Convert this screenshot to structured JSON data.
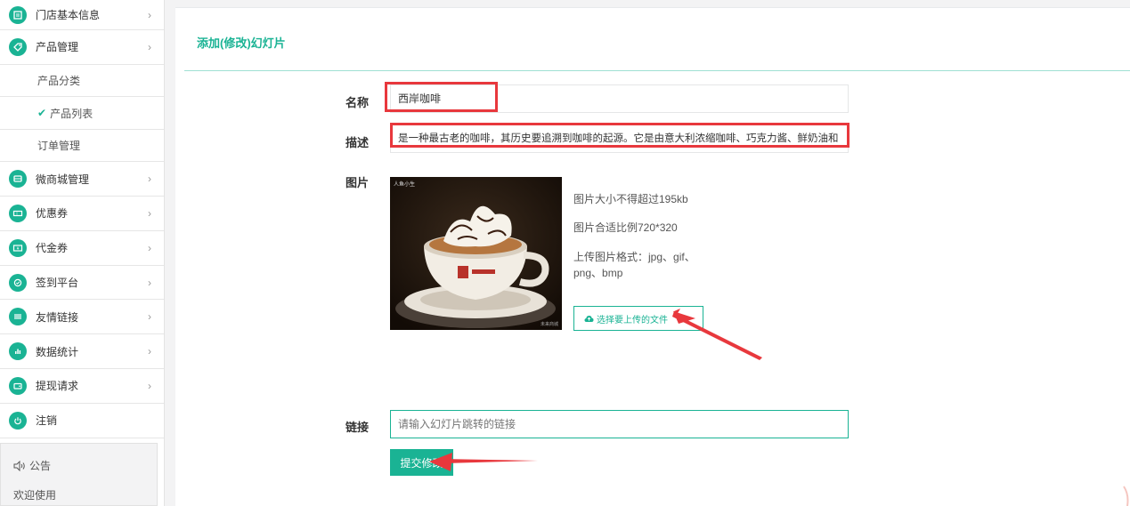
{
  "sidebar": {
    "items": [
      {
        "label": "门店基本信息",
        "icon": "store-icon",
        "chevron": "›"
      },
      {
        "label": "产品管理",
        "icon": "tag-icon",
        "chevron": "›"
      }
    ],
    "subitems": [
      {
        "label": "产品分类"
      },
      {
        "label": "产品列表",
        "check": "✔"
      },
      {
        "label": "订单管理"
      }
    ],
    "items2": [
      {
        "label": "微商城管理",
        "icon": "shop-icon",
        "chevron": "›"
      },
      {
        "label": "优惠券",
        "icon": "coupon-icon",
        "chevron": "›"
      },
      {
        "label": "代金券",
        "icon": "voucher-icon",
        "chevron": "›"
      },
      {
        "label": "签到平台",
        "icon": "checkin-icon",
        "chevron": "›"
      },
      {
        "label": "友情链接",
        "icon": "link-icon",
        "chevron": "›"
      },
      {
        "label": "数据统计",
        "icon": "chart-icon",
        "chevron": "›"
      },
      {
        "label": "提现请求",
        "icon": "wallet-icon",
        "chevron": "›"
      },
      {
        "label": "注销",
        "icon": "power-icon"
      }
    ],
    "notice": {
      "title": "公告",
      "body": "欢迎使用"
    }
  },
  "main": {
    "title": "添加(修改)幻灯片",
    "form": {
      "name_label": "名称",
      "name_value": "西岸咖啡",
      "desc_label": "描述",
      "desc_value": "是一种最古老的咖啡，其历史要追溯到咖啡的起源。它是由意大利浓缩咖啡、巧克力酱、鲜奶油和",
      "image_label": "图片",
      "image_watermark": "人鱼小生",
      "image_watermark2": "未来商城",
      "hints": [
        "图片大小不得超过195kb",
        "图片合适比例720*320",
        "上传图片格式：jpg、gif、",
        "png、bmp"
      ],
      "upload_label": "选择要上传的文件",
      "link_label": "链接",
      "link_placeholder": "请输入幻灯片跳转的链接",
      "submit_label": "提交修改"
    }
  },
  "colors": {
    "accent": "#1ab394",
    "highlight": "#e8383d"
  }
}
